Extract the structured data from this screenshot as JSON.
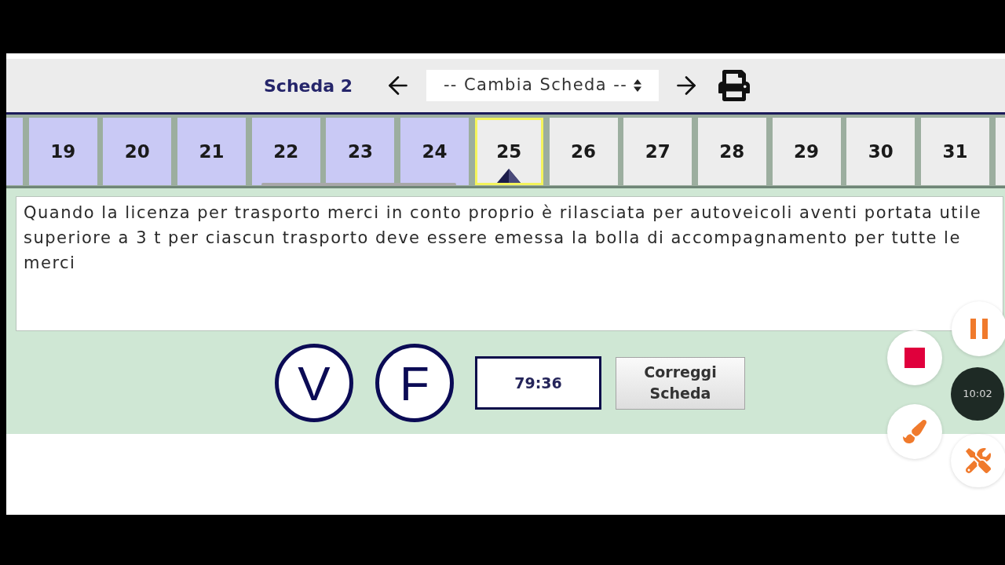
{
  "header": {
    "title": "Scheda 2",
    "selector": {
      "value": "-- Cambia Scheda --"
    }
  },
  "tabs": [
    {
      "kind": "cut",
      "answered": true,
      "selected": false
    },
    {
      "kind": "full",
      "label": "19",
      "answered": true,
      "selected": false
    },
    {
      "kind": "full",
      "label": "20",
      "answered": true,
      "selected": false
    },
    {
      "kind": "full",
      "label": "21",
      "answered": true,
      "selected": false
    },
    {
      "kind": "full",
      "label": "22",
      "answered": true,
      "selected": false
    },
    {
      "kind": "full",
      "label": "23",
      "answered": true,
      "selected": false
    },
    {
      "kind": "full",
      "label": "24",
      "answered": true,
      "selected": false
    },
    {
      "kind": "full",
      "label": "25",
      "answered": false,
      "selected": true
    },
    {
      "kind": "full",
      "label": "26",
      "answered": false,
      "selected": false
    },
    {
      "kind": "full",
      "label": "27",
      "answered": false,
      "selected": false
    },
    {
      "kind": "full",
      "label": "28",
      "answered": false,
      "selected": false
    },
    {
      "kind": "full",
      "label": "29",
      "answered": false,
      "selected": false
    },
    {
      "kind": "full",
      "label": "30",
      "answered": false,
      "selected": false
    },
    {
      "kind": "full",
      "label": "31",
      "answered": false,
      "selected": false
    },
    {
      "kind": "cut",
      "answered": false,
      "selected": false
    }
  ],
  "question": {
    "text": "Quando la licenza per trasporto merci in conto proprio è rilasciata per autoveicoli aventi portata utile superiore a 3 t per ciascun trasporto deve essere emessa la bolla di accompagnamento per tutte le merci"
  },
  "answers": [
    {
      "label": "V",
      "selected": false
    },
    {
      "label": "F",
      "selected": false
    }
  ],
  "timer": "79:36",
  "buttons": [
    "Correggi Scheda"
  ],
  "recorder": {
    "elapsed": "10:02"
  }
}
